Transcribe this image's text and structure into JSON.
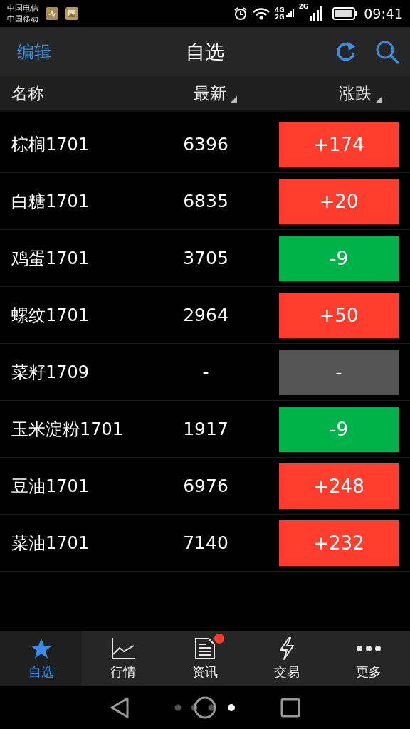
{
  "status_bar": {
    "carriers": [
      "中国电信",
      "中国移动"
    ],
    "network_1": "4G",
    "network_2": "2G",
    "network_3": "2G",
    "time": "09:41"
  },
  "header": {
    "edit": "编辑",
    "title": "自选"
  },
  "columns": [
    {
      "label": "名称",
      "sortable": false
    },
    {
      "label": "最新",
      "sortable": true
    },
    {
      "label": "涨跌",
      "sortable": true
    }
  ],
  "rows": [
    {
      "name": "棕榈1701",
      "price": "6396",
      "change": "+174",
      "kind": "up"
    },
    {
      "name": "白糖1701",
      "price": "6835",
      "change": "+20",
      "kind": "up"
    },
    {
      "name": "鸡蛋1701",
      "price": "3705",
      "change": "-9",
      "kind": "down"
    },
    {
      "name": "螺纹1701",
      "price": "2964",
      "change": "+50",
      "kind": "up"
    },
    {
      "name": "菜籽1709",
      "price": "-",
      "change": "-",
      "kind": "flat"
    },
    {
      "name": "玉米淀粉1701",
      "price": "1917",
      "change": "-9",
      "kind": "down"
    },
    {
      "name": "豆油1701",
      "price": "6976",
      "change": "+248",
      "kind": "up"
    },
    {
      "name": "菜油1701",
      "price": "7140",
      "change": "+232",
      "kind": "up"
    }
  ],
  "tab_bar": [
    {
      "label": "自选",
      "selected": true,
      "badge": false
    },
    {
      "label": "行情",
      "selected": false,
      "badge": false
    },
    {
      "label": "资讯",
      "selected": false,
      "badge": true
    },
    {
      "label": "交易",
      "selected": false,
      "badge": false
    },
    {
      "label": "更多",
      "selected": false,
      "badge": false
    }
  ]
}
